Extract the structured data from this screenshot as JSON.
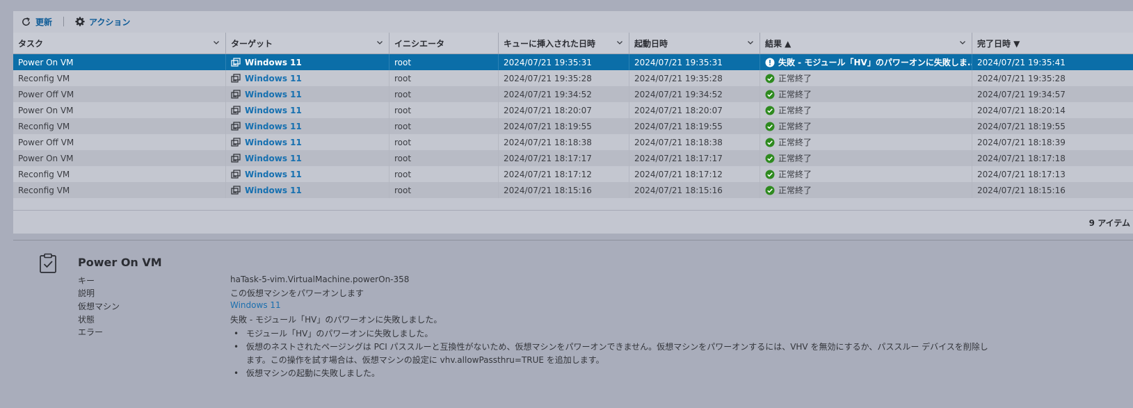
{
  "toolbar": {
    "refresh_label": "更新",
    "actions_label": "アクション"
  },
  "columns": [
    {
      "label": "タスク",
      "sort": ""
    },
    {
      "label": "ターゲット",
      "sort": ""
    },
    {
      "label": "イニシエータ",
      "sort": ""
    },
    {
      "label": "キューに挿入された日時",
      "sort": ""
    },
    {
      "label": "起動日時",
      "sort": ""
    },
    {
      "label": "結果 ▲",
      "sort": "asc"
    },
    {
      "label": "完了日時 ▼",
      "sort": "desc"
    }
  ],
  "rows": [
    {
      "task": "Power On VM",
      "target": "Windows 11",
      "initiator": "root",
      "queued": "2024/07/21 19:35:31",
      "started": "2024/07/21 19:35:31",
      "result": "失敗 - モジュール「HV」のパワーオンに失敗しま...",
      "result_status": "error",
      "completed": "2024/07/21 19:35:41"
    },
    {
      "task": "Reconfig VM",
      "target": "Windows 11",
      "initiator": "root",
      "queued": "2024/07/21 19:35:28",
      "started": "2024/07/21 19:35:28",
      "result": "正常終了",
      "result_status": "success",
      "completed": "2024/07/21 19:35:28"
    },
    {
      "task": "Power Off VM",
      "target": "Windows 11",
      "initiator": "root",
      "queued": "2024/07/21 19:34:52",
      "started": "2024/07/21 19:34:52",
      "result": "正常終了",
      "result_status": "success",
      "completed": "2024/07/21 19:34:57"
    },
    {
      "task": "Power On VM",
      "target": "Windows 11",
      "initiator": "root",
      "queued": "2024/07/21 18:20:07",
      "started": "2024/07/21 18:20:07",
      "result": "正常終了",
      "result_status": "success",
      "completed": "2024/07/21 18:20:14"
    },
    {
      "task": "Reconfig VM",
      "target": "Windows 11",
      "initiator": "root",
      "queued": "2024/07/21 18:19:55",
      "started": "2024/07/21 18:19:55",
      "result": "正常終了",
      "result_status": "success",
      "completed": "2024/07/21 18:19:55"
    },
    {
      "task": "Power Off VM",
      "target": "Windows 11",
      "initiator": "root",
      "queued": "2024/07/21 18:18:38",
      "started": "2024/07/21 18:18:38",
      "result": "正常終了",
      "result_status": "success",
      "completed": "2024/07/21 18:18:39"
    },
    {
      "task": "Power On VM",
      "target": "Windows 11",
      "initiator": "root",
      "queued": "2024/07/21 18:17:17",
      "started": "2024/07/21 18:17:17",
      "result": "正常終了",
      "result_status": "success",
      "completed": "2024/07/21 18:17:18"
    },
    {
      "task": "Reconfig VM",
      "target": "Windows 11",
      "initiator": "root",
      "queued": "2024/07/21 18:17:12",
      "started": "2024/07/21 18:17:12",
      "result": "正常終了",
      "result_status": "success",
      "completed": "2024/07/21 18:17:13"
    },
    {
      "task": "Reconfig VM",
      "target": "Windows 11",
      "initiator": "root",
      "queued": "2024/07/21 18:15:16",
      "started": "2024/07/21 18:15:16",
      "result": "正常終了",
      "result_status": "success",
      "completed": "2024/07/21 18:15:16"
    }
  ],
  "footer": {
    "item_count": "9 アイテム"
  },
  "detail": {
    "title": "Power On VM",
    "labels": {
      "key": "キー",
      "description": "説明",
      "vm": "仮想マシン",
      "state": "状態",
      "error": "エラー"
    },
    "values": {
      "key": "haTask-5-vim.VirtualMachine.powerOn-358",
      "description": "この仮想マシンをパワーオンします",
      "vm": "Windows 11",
      "state": "失敗 - モジュール「HV」のパワーオンに失敗しました。"
    },
    "errors": [
      "モジュール「HV」のパワーオンに失敗しました。",
      "仮想のネストされたページングは PCI パススルーと互換性がないため、仮想マシンをパワーオンできません。仮想マシンをパワーオンするには、VHV を無効にするか、パススルー デバイスを削除します。この操作を試す場合は、仮想マシンの設定に vhv.allowPassthru=TRUE を追加します。",
      "仮想マシンの起動に失敗しました。"
    ]
  },
  "colors": {
    "selected_row": "#0b6ea8",
    "link": "#1670b0",
    "success": "#2e8a1f",
    "background": "#a9adbb"
  }
}
